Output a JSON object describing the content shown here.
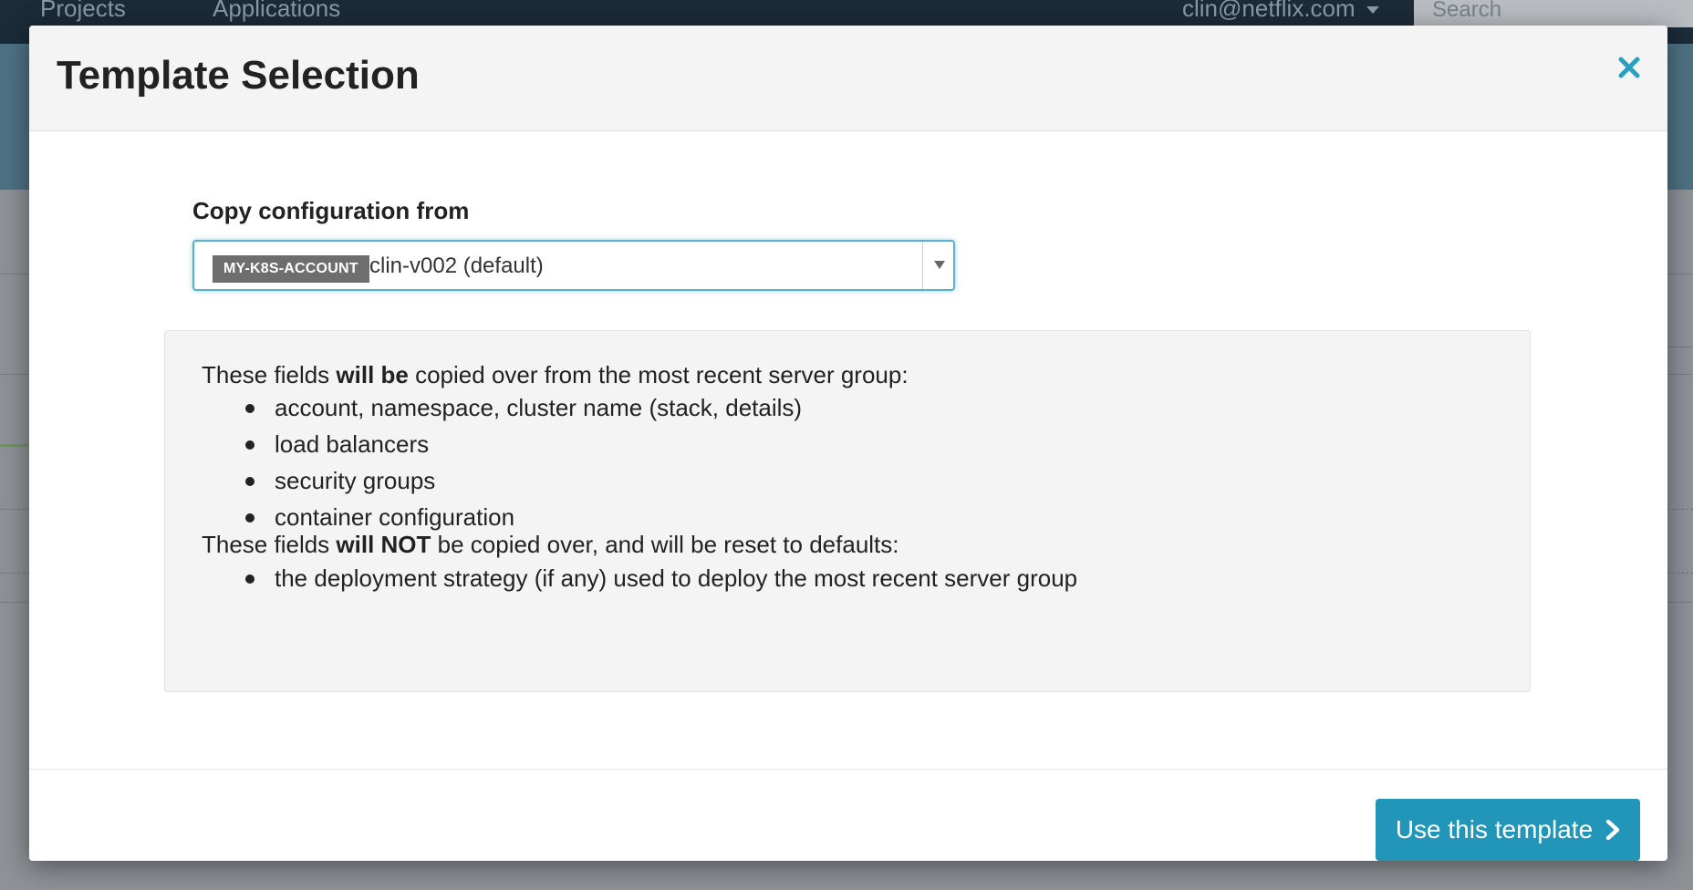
{
  "background": {
    "nav": {
      "items": [
        "Projects",
        "Applications"
      ],
      "user": "clin@netflix.com",
      "search_placeholder": "Search"
    }
  },
  "modal": {
    "title": "Template Selection",
    "close_icon": "close-icon",
    "field_label": "Copy configuration from",
    "select": {
      "account_tag": "MY-K8S-ACCOUNT",
      "value": "clin-v002 (default)"
    },
    "info": {
      "copied_intro": {
        "before": "These fields ",
        "emphasis": "will be",
        "after": " copied over from the most recent server group:"
      },
      "copied_items": [
        "account, namespace, cluster name (stack, details)",
        "load balancers",
        "security groups",
        "container configuration"
      ],
      "not_copied_intro": {
        "before": "These fields ",
        "emphasis": "will NOT",
        "after": " be copied over, and will be reset to defaults:"
      },
      "not_copied_items": [
        "the deployment strategy (if any) used to deploy the most recent server group"
      ]
    },
    "footer": {
      "primary_button_label": "Use this template",
      "primary_button_icon": "chevron-right-icon"
    }
  },
  "colors": {
    "accent": "#2296b8",
    "close_icon": "#2aa0c0",
    "tag_bg": "#6e6e6e",
    "focus_border": "#57b0d6"
  }
}
